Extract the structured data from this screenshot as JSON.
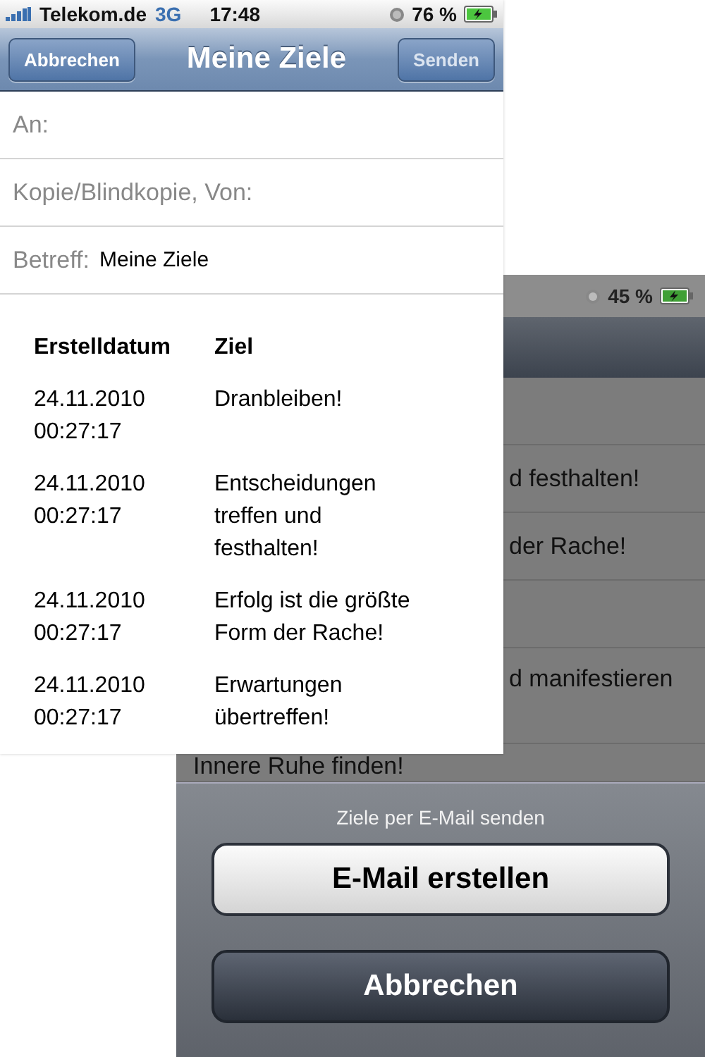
{
  "front_screen": {
    "status_bar": {
      "carrier": "Telekom.de",
      "network": "3G",
      "time": "17:48",
      "battery": "76 %"
    },
    "nav_bar": {
      "left_button": "Abbrechen",
      "title": "Meine Ziele",
      "right_button": "Senden"
    },
    "fields": [
      {
        "label": "An:"
      },
      {
        "label": "Kopie/Blindkopie, Von:"
      },
      {
        "label": "Betreff:",
        "value": "Meine Ziele"
      }
    ],
    "body_table": {
      "columns": [
        "Erstelldatum",
        "Ziel"
      ],
      "rows": [
        {
          "date": "24.11.2010 00:27:17",
          "goal": "Dranbleiben!"
        },
        {
          "date": "24.11.2010 00:27:17",
          "goal": "Entscheidungen treffen und festhalten!"
        },
        {
          "date": "24.11.2010 00:27:17",
          "goal": "Erfolg ist die größte Form der Rache!"
        },
        {
          "date": "24.11.2010 00:27:17",
          "goal": "Erwartungen übertreffen!"
        }
      ]
    }
  },
  "back_screen": {
    "status_bar": {
      "battery": "45 %"
    },
    "list": [
      {
        "kind": "short"
      },
      {
        "text": "d festhalten!",
        "kind": "short"
      },
      {
        "text": "der Rache!",
        "kind": "short"
      },
      {
        "kind": "short"
      },
      {
        "text": "d manifestieren",
        "kind": "tall"
      },
      {
        "text": "Innere Ruhe finden!",
        "kind": "wide"
      }
    ],
    "action_sheet": {
      "title": "Ziele per E-Mail senden",
      "buttons": [
        {
          "label": "E-Mail erstellen",
          "kind": "default"
        },
        {
          "label": "Abbrechen",
          "kind": "cancel"
        }
      ]
    }
  }
}
